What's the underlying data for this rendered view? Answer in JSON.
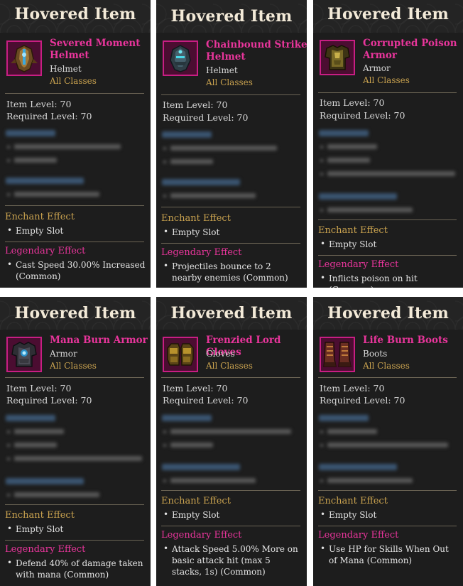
{
  "header_title": "Hovered Item",
  "labels": {
    "item_level": "Item Level: 70",
    "required_level": "Required Level: 70",
    "enchant_effect": "Enchant Effect",
    "legendary_effect": "Legendary Effect",
    "empty_slot": "Empty Slot",
    "all_classes": "All Classes"
  },
  "colors": {
    "legendary": "#e8359b",
    "gold": "#c9a24f",
    "panel": "#1d1d1d"
  },
  "cards": [
    {
      "name": "Severed Moment Helmet",
      "type": "Helmet",
      "icon": "helmet-icon",
      "legendary": "Cast Speed 30.00% Increased (Common)"
    },
    {
      "name": "Chainbound Strike Helmet",
      "type": "Helmet",
      "icon": "helmet-icon",
      "legendary": "Projectiles bounce to 2 nearby enemies (Common)"
    },
    {
      "name": "Corrupted Poison Armor",
      "type": "Armor",
      "icon": "armor-icon",
      "legendary": "Inflicts poison on hit (Common)"
    },
    {
      "name": "Mana Burn Armor",
      "type": "Armor",
      "icon": "armor-icon",
      "legendary": "Defend 40% of damage taken with mana (Common)"
    },
    {
      "name": "Frenzied Lord Gloves",
      "type": "Gloves",
      "icon": "gloves-icon",
      "legendary": "Attack Speed 5.00% More on basic attack hit (max 5 stacks, 1s) (Common)"
    },
    {
      "name": "Life Burn Boots",
      "type": "Boots",
      "icon": "boots-icon",
      "legendary": "Use HP for Skills When Out of Mana (Common)"
    }
  ]
}
